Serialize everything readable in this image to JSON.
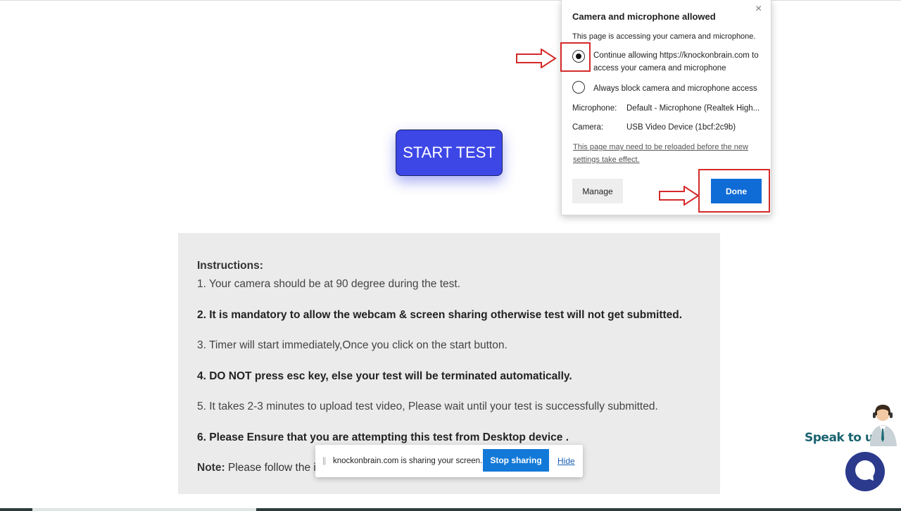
{
  "page": {
    "start_button": "START TEST"
  },
  "instructions": {
    "heading": "Instructions:",
    "line1": "1. Your camera should be at 90 degree during the test.",
    "line2": "2. It is mandatory to allow the webcam & screen sharing otherwise test will not get submitted.",
    "line3": "3. Timer will start immediately,Once you click on the start button.",
    "line4": "4. DO NOT press esc key, else your test will be terminated automatically.",
    "line5": "5. It takes 2-3 minutes to upload test video, Please wait until your test is successfully submitted.",
    "line6": "6. Please Ensure that you are attempting this test from Desktop device .",
    "note_label": "Note:",
    "note_text": " Please follow the in"
  },
  "permission_popup": {
    "title": "Camera and microphone allowed",
    "close_icon": "×",
    "description": "This page is accessing your camera and microphone.",
    "option_allow": "Continue allowing https://knockonbrain.com to access your camera and microphone",
    "option_block": "Always block camera and microphone access",
    "selected_option": "allow",
    "microphone_label": "Microphone:",
    "microphone_value": "Default - Microphone (Realtek High...",
    "camera_label": "Camera:",
    "camera_value": "USB Video Device (1bcf:2c9b)",
    "reload_note": "This page may need to be reloaded before the new settings take effect.",
    "manage_button": "Manage",
    "done_button": "Done"
  },
  "share_bar": {
    "grip_icon": "||",
    "message": "knockonbrain.com is sharing your screen.",
    "stop_button": "Stop sharing",
    "hide_link": "Hide"
  },
  "support_widget": {
    "label": "Speak to us!"
  },
  "colors": {
    "start_button": "#3d47e6",
    "highlight": "#d42a2a",
    "done_button": "#0f6cd6",
    "stop_sharing": "#1379d8",
    "instructions_bg": "#ebebeb",
    "chat_bubble": "#2b3a8c",
    "speak_text": "#1b6470"
  }
}
